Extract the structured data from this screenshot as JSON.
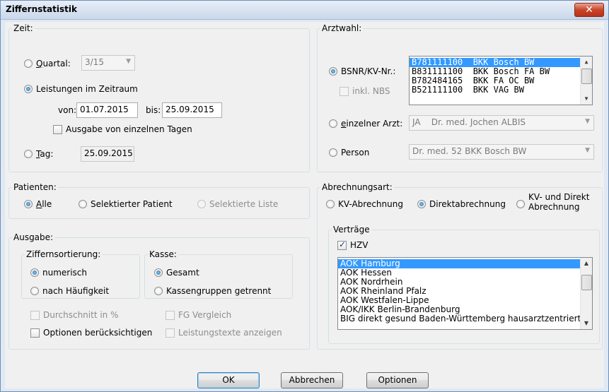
{
  "window": {
    "title": "Ziffernstatistik",
    "close_label": "✕"
  },
  "zeit": {
    "legend": "Zeit:",
    "quartal_label": "Quartal:",
    "quartal_value": "3/15",
    "leistungen_label": "Leistungen im Zeitraum",
    "von_label": "von:",
    "von_value": "01.07.2015",
    "bis_label": "bis:",
    "bis_value": "25.09.2015",
    "ausgabe_tage_label": "Ausgabe von einzelnen Tagen",
    "tag_label": "Tag:",
    "tag_value": "25.09.2015"
  },
  "patienten": {
    "legend": "Patienten:",
    "alle_label": "Alle",
    "selektierter_label": "Selektierter Patient",
    "selektierte_liste_label": "Selektierte Liste"
  },
  "ausgabe": {
    "legend": "Ausgabe:",
    "sort_legend": "Ziffernsortierung:",
    "numerisch_label": "numerisch",
    "haeufigkeit_label": "nach Häufigkeit",
    "kasse_legend": "Kasse:",
    "gesamt_label": "Gesamt",
    "kassengruppen_label": "Kassengruppen getrennt",
    "durchschnitt_label": "Durchschnitt in %",
    "fg_label": "FG Vergleich",
    "optionen_label": "Optionen berücksichtigen",
    "leistungstexte_label": "Leistungstexte anzeigen"
  },
  "arztwahl": {
    "legend": "Arztwahl:",
    "bsnr_label": "BSNR/KV-Nr.:",
    "inkl_nbs_label": "inkl. NBS",
    "bsnr_items": [
      {
        "id": "B781111100",
        "name": "BKK Bosch BW"
      },
      {
        "id": "B831111100",
        "name": "BKK Bosch FA BW"
      },
      {
        "id": "B782484165",
        "name": "BKK FA OC BW"
      },
      {
        "id": "B521111100",
        "name": "BKK VAG BW"
      }
    ],
    "einzelner_label": "einzelner Arzt:",
    "einzelner_value": "JA    Dr. med. Jochen ALBIS",
    "person_label": "Person",
    "person_value": "Dr. med. 52 BKK Bosch BW"
  },
  "abrechnung": {
    "legend": "Abrechnungsart:",
    "kv_label": "KV-Abrechnung",
    "direkt_label": "Direktabrechnung",
    "kv_direkt_line1": "KV- und Direkt",
    "kv_direkt_line2": "Abrechnung",
    "vertraege_legend": "Verträge",
    "hzv_label": "HZV",
    "vertraege_items": [
      "AOK Hamburg",
      "AOK Hessen",
      "AOK Nordrhein",
      "AOK Rheinland Pfalz",
      "AOK Westfalen-Lippe",
      "AOK/IKK Berlin-Brandenburg",
      "BIG direkt gesund Baden-Württemberg hausarztzentriert"
    ]
  },
  "buttons": {
    "ok": "OK",
    "abbrechen": "Abbrechen",
    "optionen": "Optionen"
  }
}
